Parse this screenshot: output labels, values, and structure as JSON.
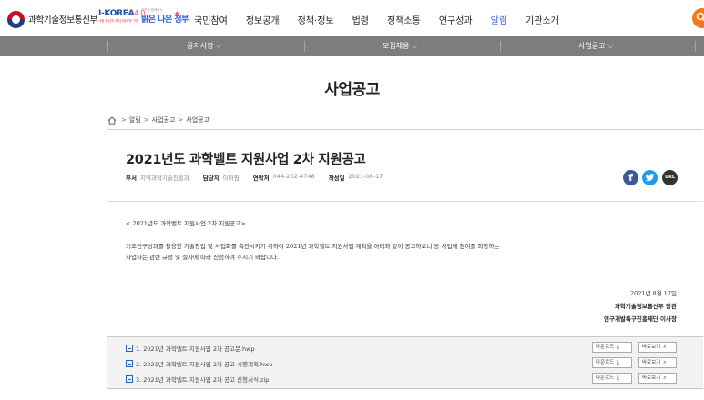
{
  "header": {
    "ministry": "과학기술정보통신부",
    "ikorea_text": "I-KOREA",
    "ikorea_num": "4.0",
    "ikorea_sub": "사람 중심의 4차산업혁명 구현",
    "bright_small": "국민과 함께하는",
    "bright_main": "밝은 나은 정부",
    "nav": [
      {
        "label": "국민참여"
      },
      {
        "label": "정보공개"
      },
      {
        "label": "정책·정보"
      },
      {
        "label": "법령"
      },
      {
        "label": "정책소통"
      },
      {
        "label": "연구성과"
      },
      {
        "label": "알림",
        "active": true
      },
      {
        "label": "기관소개"
      }
    ],
    "search_icon": "search-icon",
    "accent": "#f07a1e",
    "active_color": "#3d5fd8"
  },
  "subnav": {
    "items": [
      {
        "label": "공지사항"
      },
      {
        "label": "모집채용"
      },
      {
        "label": "사업공고"
      }
    ],
    "chevron": "⌵",
    "bg": "#7d7d7d"
  },
  "page_title": "사업공고",
  "breadcrumb": {
    "home_icon": "home-icon",
    "items": [
      "알림",
      "사업공고",
      "사업공고"
    ],
    "sep": ">"
  },
  "post": {
    "title": "2021년도 과학벨트 지원사업 2차 지원공고",
    "meta": [
      {
        "key": "부서",
        "value": "지역과학기술진흥과"
      },
      {
        "key": "담당자",
        "value": "이미림"
      },
      {
        "key": "연락처",
        "value": "044-202-4748"
      },
      {
        "key": "작성일",
        "value": "2021-08-17"
      }
    ],
    "share": {
      "facebook": "f",
      "twitter": "twitter-icon",
      "url": "URL"
    },
    "body_heading": "< 2021년도 과학벨트 지원사업 2차 지원공고>",
    "body_line1": "기초연구성과를 활용한 기술창업 및 사업화를 촉진시키기 위하여 2021년 과학벨트 지원사업 계획을 아래와 같이 공고하오니 동 사업에 참여를 희망하는",
    "body_line2": "사업자는 관련 규정 및 절차에 따라 신청하여 주시기 바랍니다.",
    "sig_date": "2021년 8월 17일",
    "sig_org1": "과학기술정보통신부 장관",
    "sig_org2": "연구개발특구진흥재단 이사장"
  },
  "attachments": {
    "download_label": "다운로드",
    "view_label": "바로보기",
    "download_icon": "download-icon",
    "view_icon": "magnifier-icon",
    "files": [
      {
        "name": "1. 2021년 과학벨트 지원사업 2차 공고문.hwp"
      },
      {
        "name": "2. 2021년 과학벨트 지원사업 2차 공고 시행계획.hwp"
      },
      {
        "name": "3. 2021년 과학벨트 지원사업 2차 공고 신청서식.zip"
      }
    ]
  }
}
